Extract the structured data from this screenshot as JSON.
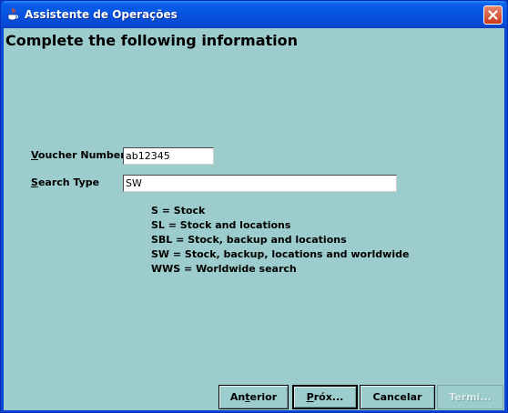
{
  "window": {
    "title": "Assistente de Operações",
    "icon": "java-cup-icon",
    "close_icon": "close-icon"
  },
  "page": {
    "heading": "Complete the following information"
  },
  "form": {
    "voucher": {
      "label_mnemonic": "V",
      "label_rest": "oucher Number",
      "value": "ab12345"
    },
    "search_type": {
      "label_mnemonic": "S",
      "label_rest": "earch Type",
      "value": "SW"
    }
  },
  "legend": [
    "S = Stock",
    "SL = Stock and locations",
    "SBL = Stock, backup and locations",
    "SW = Stock, backup, locations and worldwide",
    "WWS = Worldwide search"
  ],
  "buttons": {
    "anterior": {
      "pre": "An",
      "mnemonic": "t",
      "post": "erior"
    },
    "proximo": {
      "pre": "",
      "mnemonic": "P",
      "post": "róx..."
    },
    "cancelar": {
      "label": "Cancelar"
    },
    "terminar": {
      "label": "Termi..."
    }
  },
  "colors": {
    "titlebar": "#0654e0",
    "client_background": "#9ccccc",
    "close_button": "#c9391a"
  }
}
